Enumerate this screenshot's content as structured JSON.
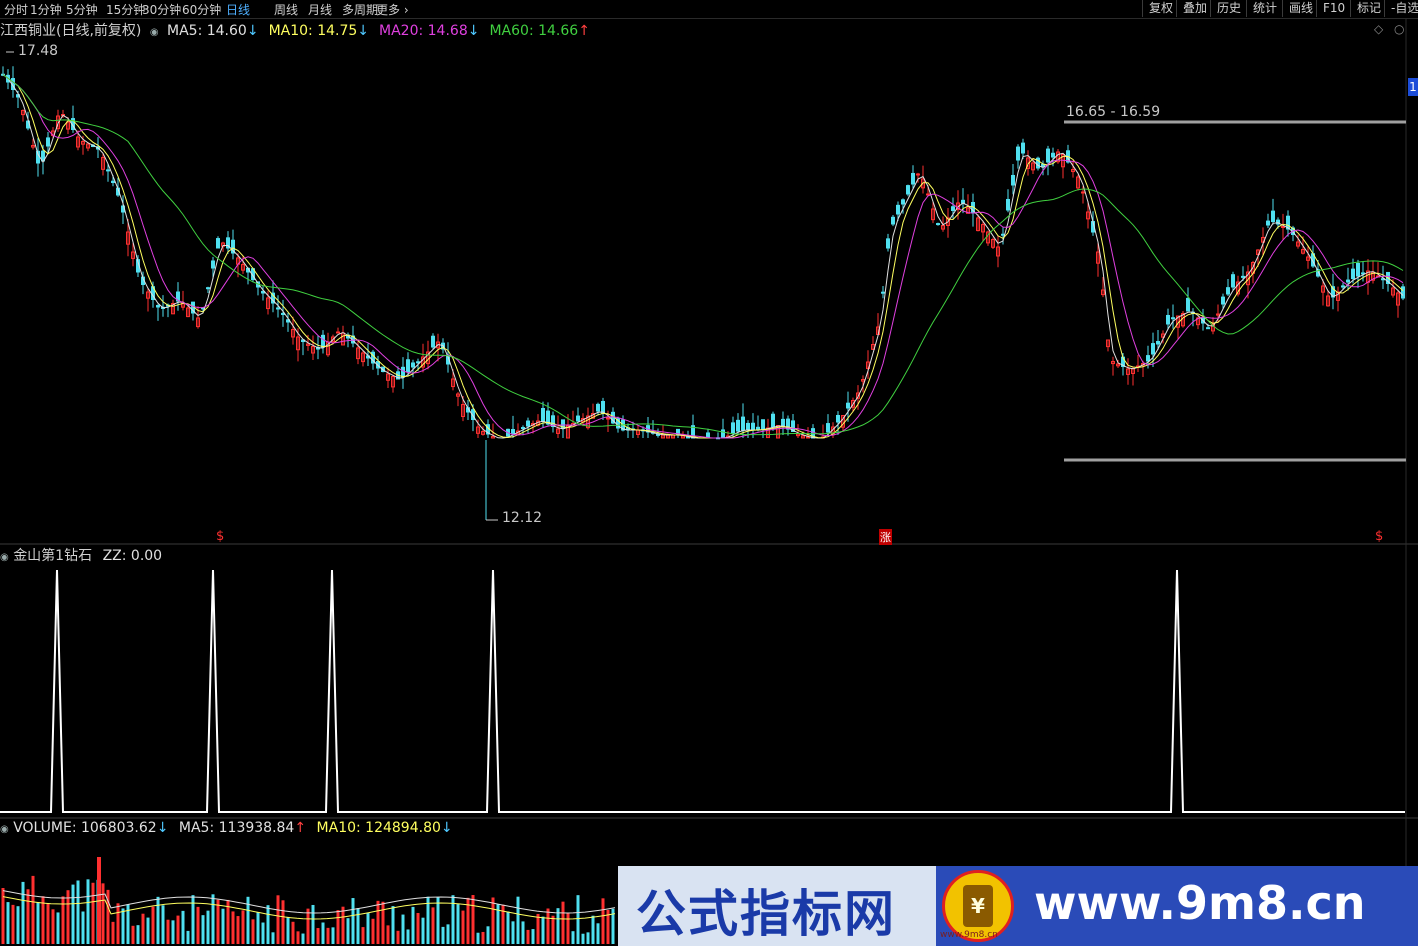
{
  "toolbar": {
    "periods": [
      "分时",
      "1分钟",
      "5分钟",
      "15分钟",
      "30分钟",
      "60分钟",
      "日线",
      "周线",
      "月线",
      "多周期",
      "更多"
    ],
    "active_period": "日线",
    "right_buttons": [
      "复权",
      "叠加",
      "历史",
      "统计",
      "画线",
      "F10",
      "标记",
      "-自选"
    ]
  },
  "main_panel": {
    "title": "江西铜业(日线,前复权)",
    "ma": [
      {
        "label": "MA5:",
        "value": "14.60",
        "arrow": "↓",
        "color": "#e0e0e0",
        "arrow_color": "#4fc8ff"
      },
      {
        "label": "MA10:",
        "value": "14.75",
        "arrow": "↓",
        "color": "#ffff60",
        "arrow_color": "#4fc8ff"
      },
      {
        "label": "MA20:",
        "value": "14.68",
        "arrow": "↓",
        "color": "#e040e0",
        "arrow_color": "#4fc8ff"
      },
      {
        "label": "MA60:",
        "value": "14.66",
        "arrow": "↑",
        "color": "#40d040",
        "arrow_color": "#ff4040"
      }
    ],
    "high_label": "17.48",
    "low_label": "12.12",
    "range_label": "16.65 - 16.59",
    "marker_s1": "$",
    "marker_zhang": "涨",
    "marker_s2": "$",
    "right_badge": "1"
  },
  "indicator_panel": {
    "title": "金山第1钻石",
    "series_label": "ZZ:",
    "series_value": "0.00"
  },
  "volume_panel": {
    "title": "VOLUME:",
    "value": "106803.62",
    "value_arrow": "↓",
    "ma5_label": "MA5:",
    "ma5_value": "113938.84",
    "ma5_arrow": "↑",
    "ma10_label": "MA10:",
    "ma10_value": "124894.80",
    "ma10_arrow": "↓"
  },
  "watermark": {
    "left_text": "公式指标网",
    "right_text": "www.9m8.cn",
    "logo_sub": "www.9m8.cn"
  },
  "colors": {
    "up": "#ff3030",
    "down": "#4fe0f0",
    "ma5": "#e0e0e0",
    "ma10": "#ffff60",
    "ma20": "#e040e0",
    "ma60": "#40d040"
  }
}
